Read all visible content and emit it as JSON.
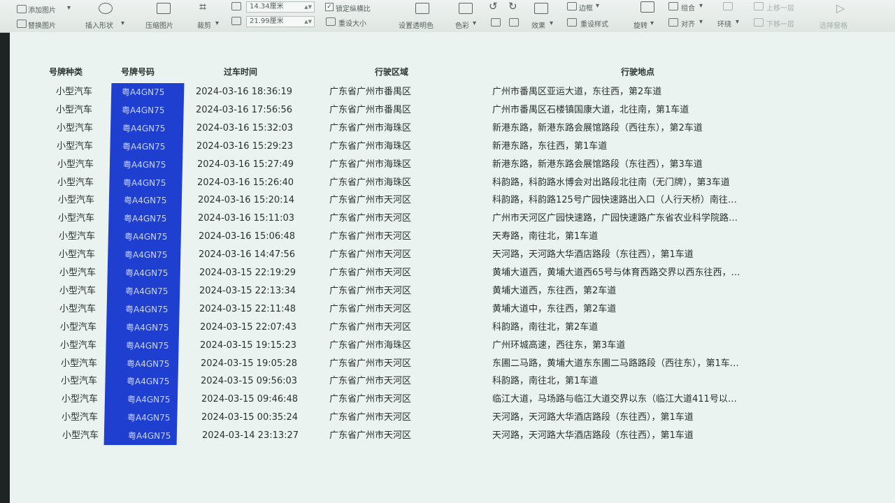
{
  "ribbon": {
    "add_picture": "添加图片",
    "replace_picture": "替换图片",
    "insert_shape": "插入形状",
    "compress_picture": "压缩图片",
    "crop": "裁剪",
    "height_value": "14.34厘米",
    "width_value": "21.99厘米",
    "lock_ratio": "锁定纵横比",
    "reset_size": "重设大小",
    "set_transparent": "设置透明色",
    "color": "色彩",
    "effects": "效果",
    "border": "边框",
    "reset_style": "重设样式",
    "rotate": "旋转",
    "combine": "组合",
    "align": "对齐",
    "wrap": "环绕",
    "move_up": "上移一层",
    "move_down": "下移一层",
    "selection_pane": "选择窗格"
  },
  "table": {
    "headers": [
      "号牌种类",
      "号牌号码",
      "过车时间",
      "行驶区域",
      "行驶地点"
    ],
    "rows": [
      [
        "小型汽车",
        "粤A4GN75",
        "2024-03-16 18:36:19",
        "广东省广州市番禺区",
        "广州市番禺区亚运大道，东往西，第2车道"
      ],
      [
        "小型汽车",
        "粤A4GN75",
        "2024-03-16 17:56:56",
        "广东省广州市番禺区",
        "广州市番禺区石楼镇国康大道，北往南，第1车道"
      ],
      [
        "小型汽车",
        "粤A4GN75",
        "2024-03-16 15:32:03",
        "广东省广州市海珠区",
        "新港东路，新港东路会展馆路段（西往东），第2车道"
      ],
      [
        "小型汽车",
        "粤A4GN75",
        "2024-03-16 15:29:23",
        "广东省广州市海珠区",
        "新港东路，东往西，第1车道"
      ],
      [
        "小型汽车",
        "粤A4GN75",
        "2024-03-16 15:27:49",
        "广东省广州市海珠区",
        "新港东路，新港东路会展馆路段（东往西），第3车道"
      ],
      [
        "小型汽车",
        "粤A4GN75",
        "2024-03-16 15:26:40",
        "广东省广州市海珠区",
        "科韵路，科韵路水博会对出路段北往南（无门牌），第3车道"
      ],
      [
        "小型汽车",
        "粤A4GN75",
        "2024-03-16 15:20:14",
        "广东省广州市天河区",
        "科韵路，科韵路125号广园快速路出入口（人行天桥）南往…"
      ],
      [
        "小型汽车",
        "粤A4GN75",
        "2024-03-16 15:11:03",
        "广东省广州市天河区",
        "广州市天河区广园快速路，广园快速路广东省农业科学院路…"
      ],
      [
        "小型汽车",
        "粤A4GN75",
        "2024-03-16 15:06:48",
        "广东省广州市天河区",
        "天寿路，南往北，第1车道"
      ],
      [
        "小型汽车",
        "粤A4GN75",
        "2024-03-16 14:47:56",
        "广东省广州市天河区",
        "天河路，天河路大华酒店路段（东往西），第1车道"
      ],
      [
        "小型汽车",
        "粤A4GN75",
        "2024-03-15 22:19:29",
        "广东省广州市天河区",
        "黄埔大道西，黄埔大道西65号与体育西路交界以西东往西，…"
      ],
      [
        "小型汽车",
        "粤A4GN75",
        "2024-03-15 22:13:34",
        "广东省广州市天河区",
        "黄埔大道西，东往西，第2车道"
      ],
      [
        "小型汽车",
        "粤A4GN75",
        "2024-03-15 22:11:48",
        "广东省广州市天河区",
        "黄埔大道中，东往西，第2车道"
      ],
      [
        "小型汽车",
        "粤A4GN75",
        "2024-03-15 22:07:43",
        "广东省广州市天河区",
        "科韵路，南往北，第2车道"
      ],
      [
        "小型汽车",
        "粤A4GN75",
        "2024-03-15 19:15:23",
        "广东省广州市海珠区",
        "广州环城高速，西往东，第3车道"
      ],
      [
        "小型汽车",
        "粤A4GN75",
        "2024-03-15 19:05:28",
        "广东省广州市天河区",
        "东圃二马路，黄埔大道东东圃二马路路段（西往东），第1车…"
      ],
      [
        "小型汽车",
        "粤A4GN75",
        "2024-03-15 09:56:03",
        "广东省广州市天河区",
        "科韵路，南往北，第1车道"
      ],
      [
        "小型汽车",
        "粤A4GN75",
        "2024-03-15 09:46:48",
        "广东省广州市天河区",
        "临江大道，马场路与临江大道交界以东（临江大道411号以…"
      ],
      [
        "小型汽车",
        "粤A4GN75",
        "2024-03-15 00:35:24",
        "广东省广州市天河区",
        "天河路，天河路大华酒店路段（东往西），第1车道"
      ],
      [
        "小型汽车",
        "粤A4GN75",
        "2024-03-14 23:13:27",
        "广东省广州市天河区",
        "天河路，天河路大华酒店路段（东往西），第1车道"
      ]
    ]
  },
  "colors": {
    "plate_highlight": "#1f3fd1",
    "sheet_background": "#eaf3ef"
  }
}
